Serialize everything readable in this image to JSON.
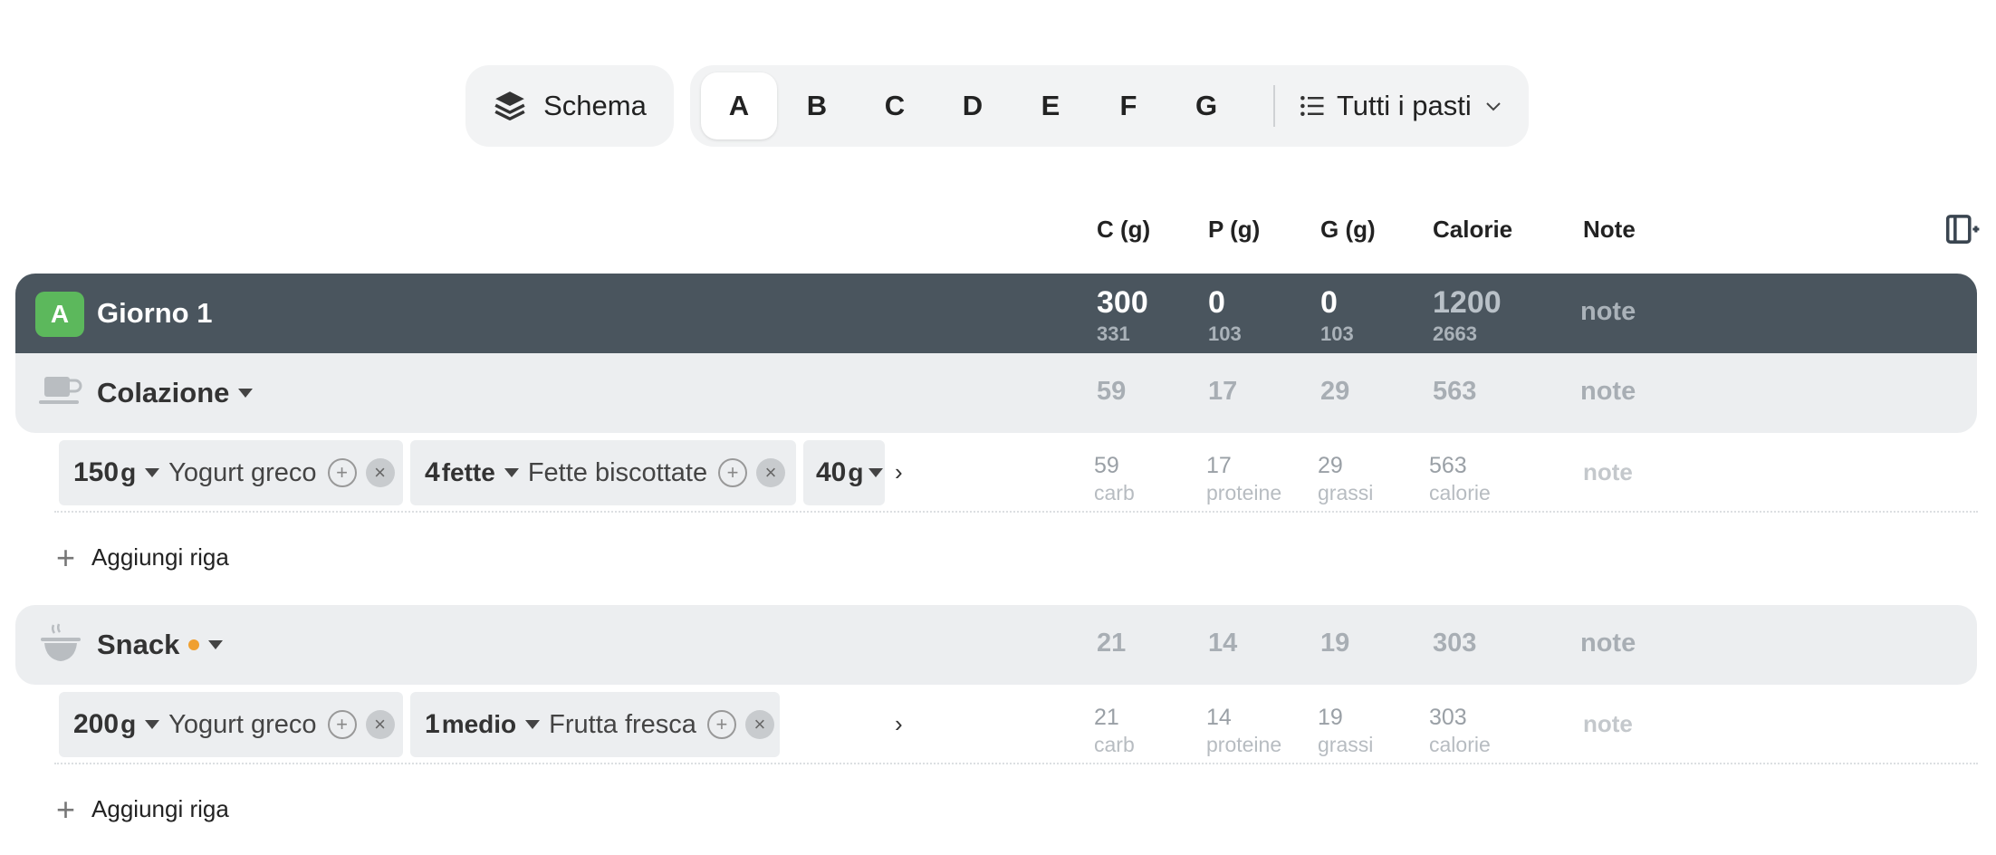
{
  "toolbar": {
    "schema_label": "Schema",
    "days": [
      "A",
      "B",
      "C",
      "D",
      "E",
      "F",
      "G"
    ],
    "active_day": "A",
    "meals_filter": "Tutti i pasti"
  },
  "columns": {
    "carbs": "C (g)",
    "protein": "P (g)",
    "fat": "G (g)",
    "calories": "Calorie",
    "notes": "Note"
  },
  "day": {
    "badge": "A",
    "title": "Giorno 1",
    "carbs": "300",
    "carbs_target": "331",
    "protein": "0",
    "protein_target": "103",
    "fat": "0",
    "fat_target": "103",
    "calories": "1200",
    "calories_target": "2663",
    "note": "note"
  },
  "meals": [
    {
      "title": "Colazione",
      "icon": "coffee-cup-icon",
      "carbs": "59",
      "protein": "17",
      "fat": "29",
      "calories": "563",
      "note": "note",
      "foods": [
        {
          "qty": "150",
          "unit": "g",
          "name": "Yogurt greco"
        },
        {
          "qty": "4",
          "unit": "fette",
          "name": "Fette biscottate"
        },
        {
          "qty": "40",
          "unit": "g",
          "name": ""
        }
      ],
      "row": {
        "carbs": "59",
        "protein": "17",
        "fat": "29",
        "calories": "563",
        "note": "note"
      },
      "add_label": "Aggiungi riga"
    },
    {
      "title": "Snack",
      "icon": "bowl-icon",
      "carbs": "21",
      "protein": "14",
      "fat": "19",
      "calories": "303",
      "note": "note",
      "foods": [
        {
          "qty": "200",
          "unit": "g",
          "name": "Yogurt greco"
        },
        {
          "qty": "1",
          "unit": "medio",
          "name": "Frutta fresca"
        }
      ],
      "row": {
        "carbs": "21",
        "protein": "14",
        "fat": "19",
        "calories": "303",
        "note": "note"
      },
      "add_label": "Aggiungi riga"
    }
  ],
  "units": {
    "carbs": "carb",
    "protein": "proteine",
    "fat": "grassi",
    "calories": "calorie"
  },
  "colors": {
    "day_header": "#4a555e",
    "badge": "#5cb85c",
    "meal_header": "#eceef0",
    "snack_dot": "#f0a030"
  }
}
